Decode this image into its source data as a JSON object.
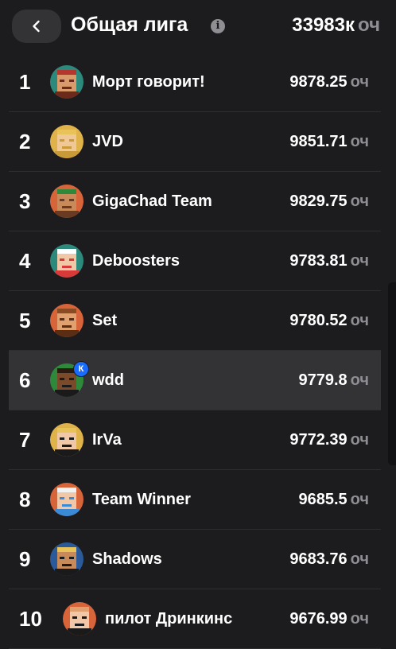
{
  "header": {
    "title": "Общая лига",
    "total_value": "33983к",
    "total_unit": "оч"
  },
  "leaderboard": [
    {
      "rank": "1",
      "name": "Морт говорит!",
      "score": "9878.25",
      "unit": "оч",
      "avatar": "pixel-avatar-red-cap",
      "current_user": false
    },
    {
      "rank": "2",
      "name": "JVD",
      "score": "9851.71",
      "unit": "оч",
      "avatar": "pixel-avatar-blonde",
      "current_user": false
    },
    {
      "rank": "3",
      "name": "GigaChad Team",
      "score": "9829.75",
      "unit": "оч",
      "avatar": "pixel-avatar-green-cap",
      "current_user": false
    },
    {
      "rank": "4",
      "name": "Deboosters",
      "score": "9783.81",
      "unit": "оч",
      "avatar": "pixel-avatar-nurse",
      "current_user": false
    },
    {
      "rank": "5",
      "name": "Set",
      "score": "9780.52",
      "unit": "оч",
      "avatar": "pixel-avatar-mustache",
      "current_user": false
    },
    {
      "rank": "6",
      "name": "wdd",
      "score": "9779.8",
      "unit": "оч",
      "avatar": "pixel-avatar-dark",
      "current_user": true,
      "badge": "К"
    },
    {
      "rank": "7",
      "name": "IrVa",
      "score": "9772.39",
      "unit": "оч",
      "avatar": "pixel-avatar-blonde-suit",
      "current_user": false
    },
    {
      "rank": "8",
      "name": "Team Winner",
      "score": "9685.5",
      "unit": "оч",
      "avatar": "pixel-avatar-white-hair",
      "current_user": false
    },
    {
      "rank": "9",
      "name": "Shadows",
      "score": "9683.76",
      "unit": "оч",
      "avatar": "pixel-avatar-sunglasses",
      "current_user": false
    },
    {
      "rank": "10",
      "name": "пилот Дринкинс",
      "score": "9676.99",
      "unit": "оч",
      "avatar": "pixel-avatar-bald",
      "current_user": false
    }
  ],
  "colors": {
    "background": "#1c1c1e",
    "highlight_row": "#333336",
    "muted_text": "#8e8e93",
    "badge": "#1a6bff"
  }
}
